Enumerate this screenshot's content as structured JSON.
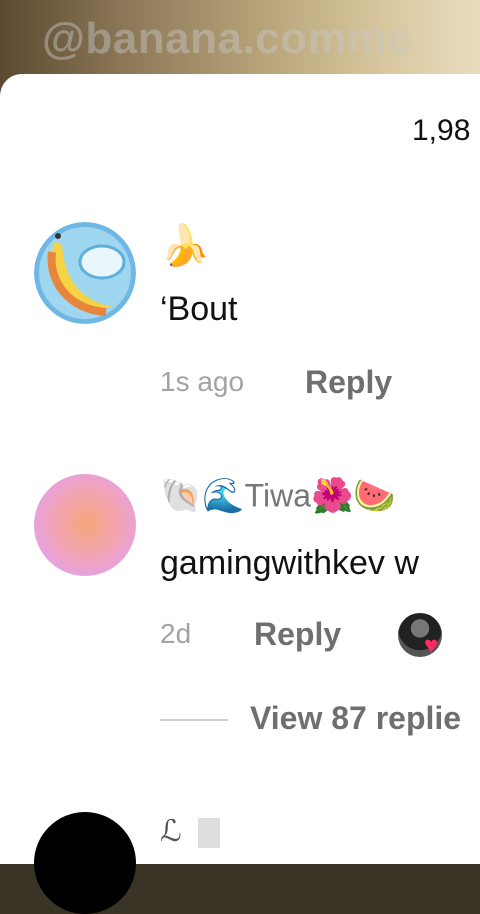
{
  "watermark": "@banana.comme",
  "comments_count": "1,98",
  "comments": [
    {
      "emojis": "🍌",
      "text": "‘Bout",
      "time": "1s ago",
      "reply_label": "Reply"
    },
    {
      "name_prefix_emojis": "🐚🌊",
      "name": "Tiwa",
      "name_suffix_emojis": "🌺🍉",
      "text": "gamingwithkev w",
      "time": "2d",
      "reply_label": "Reply",
      "view_replies": "View 87 replie"
    },
    {
      "name_prefix": "ℒ"
    }
  ]
}
